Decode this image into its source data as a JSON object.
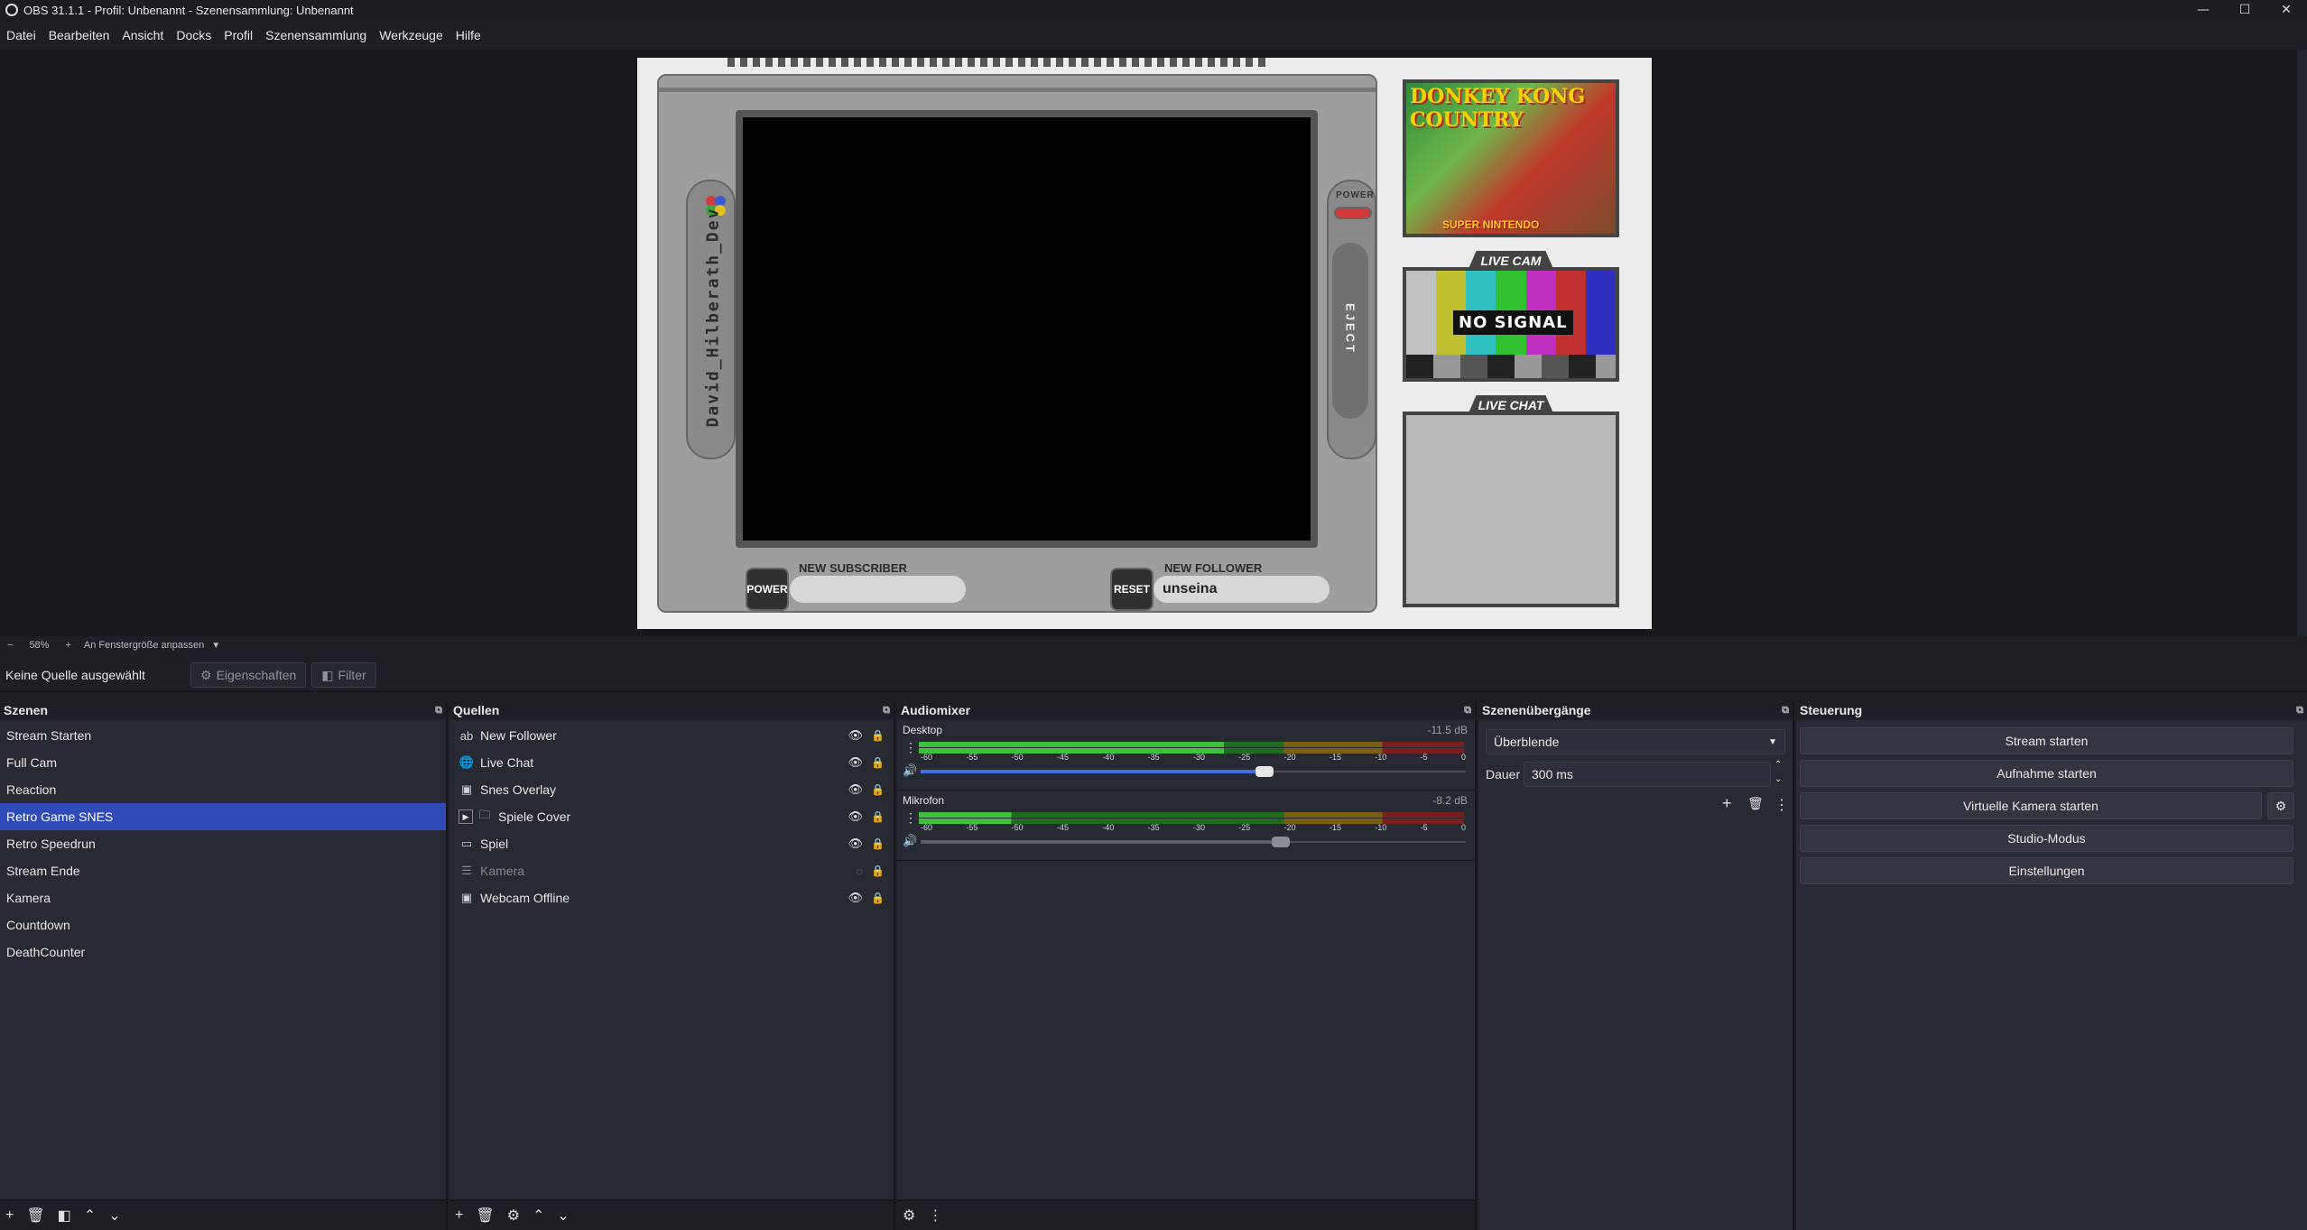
{
  "window": {
    "title": "OBS 31.1.1 - Profil: Unbenannt - Szenensammlung: Unbenannt",
    "minimize": "—",
    "maximize": "☐",
    "close": "✕"
  },
  "menu": [
    "Datei",
    "Bearbeiten",
    "Ansicht",
    "Docks",
    "Profil",
    "Szenensammlung",
    "Werkzeuge",
    "Hilfe"
  ],
  "canvas": {
    "nickname": "David_Hilberath_Dev",
    "power_label": "POWER",
    "eject_label": "EJECT",
    "btn_power": "POWER",
    "btn_reset": "RESET",
    "new_subscriber_label": "NEW SUBSCRIBER",
    "new_subscriber_value": "",
    "new_follower_label": "NEW FOLLOWER",
    "new_follower_value": "unseina",
    "cover_title": "DONKEY KONG COUNTRY",
    "cover_sub": "SUPER NINTENDO",
    "live_cam_label": "LIVE CAM",
    "no_signal": "NO SIGNAL",
    "live_chat_label": "LIVE CHAT"
  },
  "zoom": {
    "minus": "−",
    "value": "58%",
    "plus": "+",
    "fit": "An Fenstergröße anpassen",
    "dropdown": "▼"
  },
  "source_toolbar": {
    "no_source": "Keine Quelle ausgewählt",
    "properties": "Eigenschaften",
    "filter": "Filter"
  },
  "scenes": {
    "title": "Szenen",
    "items": [
      "Stream Starten",
      "Full Cam",
      "Reaction",
      "Retro Game SNES",
      "Retro Speedrun",
      "Stream Ende",
      "Kamera",
      "Countdown",
      "DeathCounter"
    ],
    "active_index": 3
  },
  "sources": {
    "title": "Quellen",
    "items": [
      {
        "name": "New Follower",
        "icon": "ab",
        "visible": true
      },
      {
        "name": "Live Chat",
        "icon": "globe",
        "visible": true
      },
      {
        "name": "Snes Overlay",
        "icon": "image",
        "visible": true
      },
      {
        "name": "Spiele Cover",
        "icon": "folder",
        "visible": true
      },
      {
        "name": "Spiel",
        "icon": "window",
        "visible": true
      },
      {
        "name": "Kamera",
        "icon": "list",
        "visible": false
      },
      {
        "name": "Webcam Offline",
        "icon": "image",
        "visible": true
      }
    ]
  },
  "mixer": {
    "title": "Audiomixer",
    "scale": [
      "-60",
      "-55",
      "-50",
      "-45",
      "-40",
      "-35",
      "-30",
      "-25",
      "-20",
      "-15",
      "-10",
      "-5",
      "0"
    ],
    "channels": [
      {
        "name": "Desktop",
        "db": "-11.5 dB",
        "level": 0.56,
        "fader": 0.63
      },
      {
        "name": "Mikrofon",
        "db": "-8.2 dB",
        "level": 0.17,
        "fader": 0.66
      }
    ]
  },
  "transitions": {
    "title": "Szenenübergänge",
    "selected": "Überblende",
    "duration_label": "Dauer",
    "duration_value": "300 ms"
  },
  "controls": {
    "title": "Steuerung",
    "stream": "Stream starten",
    "record": "Aufnahme starten",
    "virtualcam": "Virtuelle Kamera starten",
    "studio": "Studio-Modus",
    "settings": "Einstellungen"
  },
  "colors": {
    "accent": "#2f4bb8",
    "meter_green": "#3fbf3f",
    "meter_yellow": "#c9a227",
    "meter_red": "#c0392b"
  }
}
